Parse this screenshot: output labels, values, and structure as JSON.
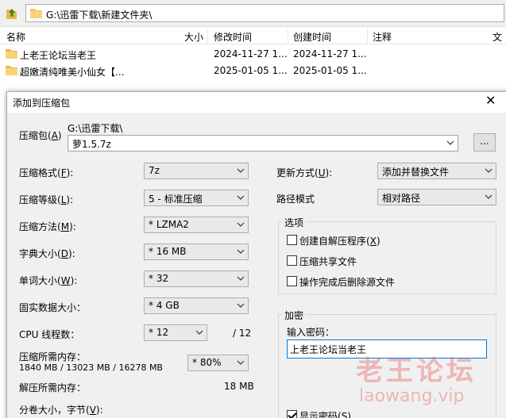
{
  "explorer": {
    "address": "G:\\迅雷下载\\新建文件夹\\",
    "columns": {
      "name": "名称",
      "size": "大小",
      "modified": "修改时间",
      "created": "创建时间",
      "comment": "注释",
      "folders": "文"
    },
    "rows": [
      {
        "name": "上老王论坛当老王",
        "modified": "2024-11-27 1...",
        "created": "2024-11-27 1..."
      },
      {
        "name": "超嫩清纯唯美小仙女【...",
        "modified": "2025-01-05 1...",
        "created": "2025-01-05 1..."
      }
    ]
  },
  "dialog": {
    "title": "添加到压缩包",
    "archive_label": "压缩包",
    "archive_key": "A",
    "archive_path": "G:\\迅雷下载\\",
    "archive_name": "萝1.5.7z",
    "browse": "...",
    "format_label": "压缩格式",
    "format_key": "F",
    "format_value": "7z",
    "level_label": "压缩等级",
    "level_key": "L",
    "level_value": "5 - 标准压缩",
    "method_label": "压缩方法",
    "method_key": "M",
    "method_value": "* LZMA2",
    "dict_label": "字典大小",
    "dict_key": "D",
    "dict_value": "* 16 MB",
    "word_label": "单词大小",
    "word_key": "W",
    "word_value": "* 32",
    "solid_label": "固实数据大小：",
    "solid_value": "* 4 GB",
    "cpu_label": "CPU 线程数：",
    "cpu_value": "* 12",
    "cpu_total": "/ 12",
    "mem_label": "压缩所需内存：",
    "mem_detail": "1840 MB / 13023 MB / 16278 MB",
    "mem_value": "* 80%",
    "decomp_label": "解压所需内存：",
    "decomp_value": "18 MB",
    "split_label": "分卷大小，字节",
    "split_key": "V",
    "update_label": "更新方式",
    "update_key": "U",
    "update_value": "添加并替换文件",
    "path_label": "路径模式",
    "path_value": "相对路径",
    "options_title": "选项",
    "opt_sfx": "创建自解压程序",
    "opt_sfx_key": "X",
    "opt_shared": "压缩共享文件",
    "opt_delete": "操作完成后删除源文件",
    "enc_title": "加密",
    "pwd_label": "输入密码：",
    "pwd_value": "上老王论坛当老王",
    "show_pwd": "显示密码",
    "show_pwd_key": "S"
  },
  "watermark": {
    "line1": "老王论坛",
    "line2": "laowang.vip"
  },
  "colors": {
    "accent": "#0078d7",
    "folder": "#f2c55c"
  }
}
